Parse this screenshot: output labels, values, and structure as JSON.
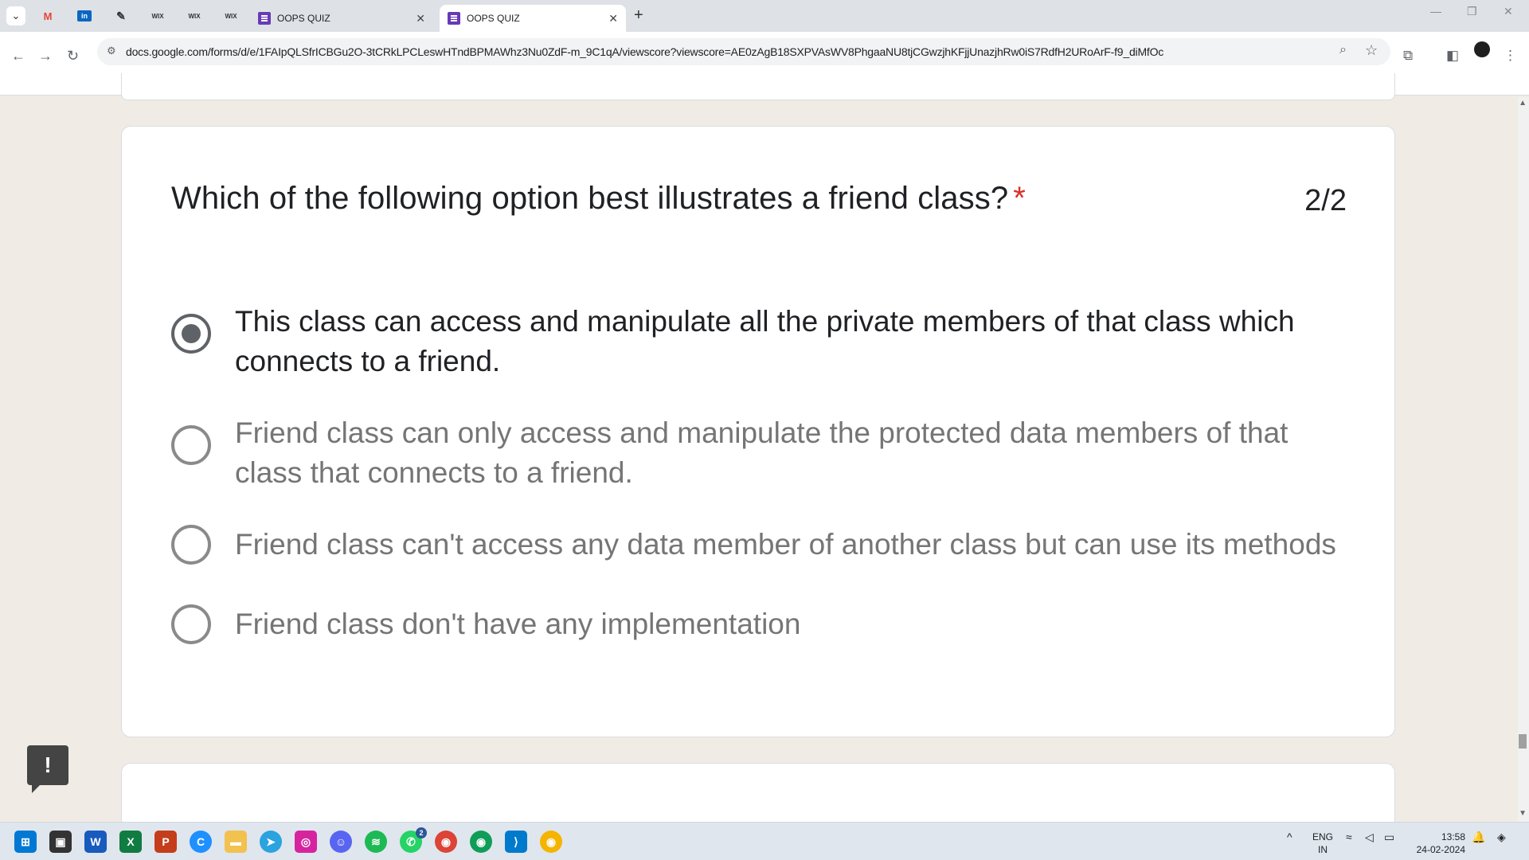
{
  "browser": {
    "tabs": [
      {
        "title": "OOPS QUIZ",
        "active": false
      },
      {
        "title": "OOPS QUIZ",
        "active": true
      }
    ],
    "pinned": [
      "gmail-icon",
      "linkedin-icon",
      "pen-icon",
      "wix-icon",
      "wix-icon",
      "wix-icon"
    ],
    "pinned_labels": {
      "wix": "WIX"
    },
    "url": "docs.google.com/forms/d/e/1FAIpQLSfrICBGu2O-3tCRkLPCLeswHTndBPMAWhz3Nu0ZdF-m_9C1qA/viewscore?viewscore=AE0zAgB18SXPVAsWV8PhgaaNU8tjCGwzjhKFjjUnazjhRw0iS7RdfH2URoArF-f9_diMfOc"
  },
  "question": {
    "text": "Which of the following option best illustrates a friend class?",
    "required_mark": "*",
    "score": "2/2",
    "options": [
      {
        "text": "This class can access and manipulate all the private members of that class which connects to a friend.",
        "selected": true
      },
      {
        "text": "Friend class can only access and manipulate the protected data members of that class that connects to a friend.",
        "selected": false
      },
      {
        "text": "Friend class can't access any data member of another class but can use its methods",
        "selected": false
      },
      {
        "text": "Friend class don't have any implementation",
        "selected": false
      }
    ]
  },
  "feedback_label": "!",
  "taskbar": {
    "lang": "ENG",
    "region": "IN",
    "time": "13:58",
    "date": "24-02-2024",
    "whatsapp_badge": "2"
  },
  "colors": {
    "page_bg": "#f1ebe6",
    "required": "#d93025",
    "forms_purple": "#673ab7"
  }
}
